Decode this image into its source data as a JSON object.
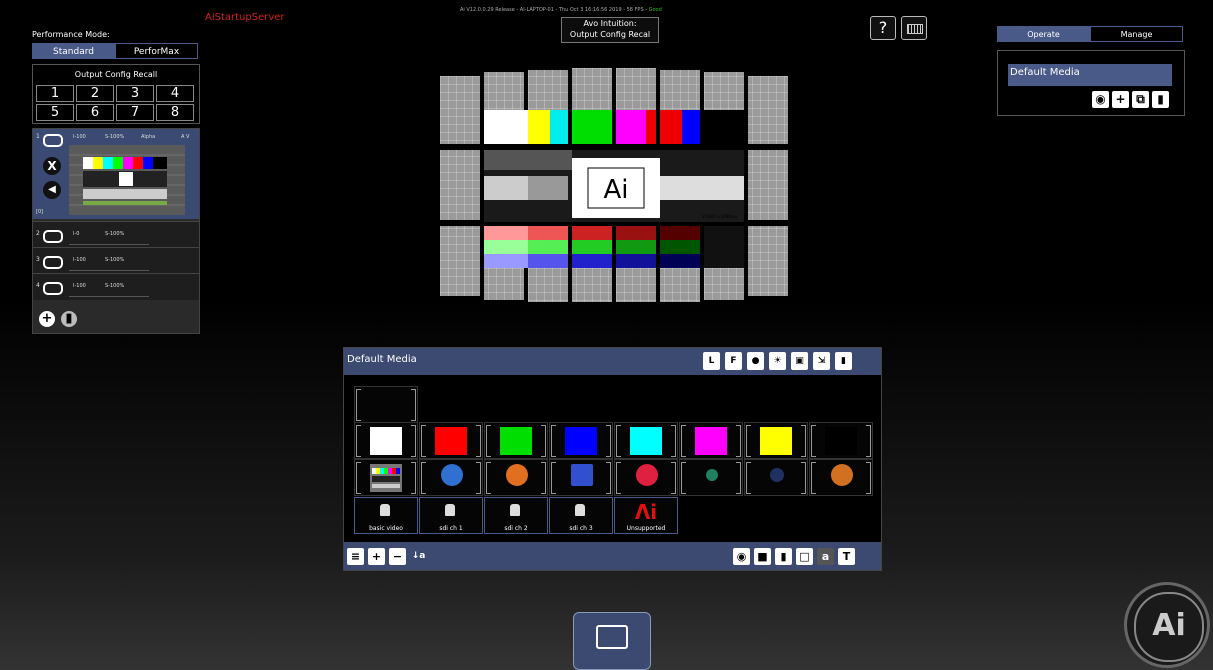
{
  "server_label": "AiStartupServer",
  "status_line": "Ai V12.0.0.29 Release - AI-LAPTOP-01 - Thu Oct  3 16:16:56 2019 - 58 FPS -",
  "status_ok": "Good",
  "window_title": {
    "line1": "Avo Intuition:",
    "line2": "Output Config Recal"
  },
  "help_label": "?",
  "performance": {
    "label": "Performance Mode:",
    "options": [
      "Standard",
      "PerforMax"
    ],
    "selected": "Standard"
  },
  "output_recall": {
    "title": "Output Config Recall",
    "slots": [
      "1",
      "2",
      "3",
      "4",
      "5",
      "6",
      "7",
      "8"
    ]
  },
  "layers": [
    {
      "num": "1",
      "intensity": "I-100",
      "speed": "S-100%",
      "blend": "Alpha",
      "av": "A V",
      "index": "[0]"
    },
    {
      "num": "2",
      "intensity": "I-0",
      "speed": "S-100%"
    },
    {
      "num": "3",
      "intensity": "I-100",
      "speed": "S-100%"
    },
    {
      "num": "4",
      "intensity": "I-100",
      "speed": "S-100%"
    }
  ],
  "preview_label": "V:1920 x 1080 px",
  "right_panel": {
    "tabs": [
      "Operate",
      "Manage"
    ],
    "selected_tab": "Operate",
    "media_list": [
      "Default Media"
    ]
  },
  "media_browser": {
    "title": "Default Media",
    "top_tools": [
      "lock-l-icon",
      "lock-f-icon",
      "people-icon",
      "light-icon",
      "camera-icon",
      "resize-icon",
      "trash-icon"
    ],
    "colors": [
      "#ffffff",
      "#ff0000",
      "#00dd00",
      "#0000ff",
      "#00ffff",
      "#ff00ff",
      "#ffff00",
      "#000000"
    ],
    "generative_colors": [
      "#3070d0",
      "#e07020",
      "#3050d0",
      "#e02040",
      "#208060",
      "#203060",
      "#d07020"
    ],
    "video_inputs": [
      "basic video",
      "sdi ch 1",
      "sdi ch 2",
      "sdi ch 3"
    ],
    "unsupported_label": "Unsupported",
    "footer_left_tools": [
      "sort-icon",
      "plus-icon",
      "minus-icon",
      "az-sort-icon"
    ],
    "footer_right_tools": [
      "thumbnail-icon",
      "folder-icon",
      "mouse-icon",
      "square-icon",
      "letter-a-icon",
      "letter-t-icon"
    ]
  },
  "logo_text": "Ai"
}
